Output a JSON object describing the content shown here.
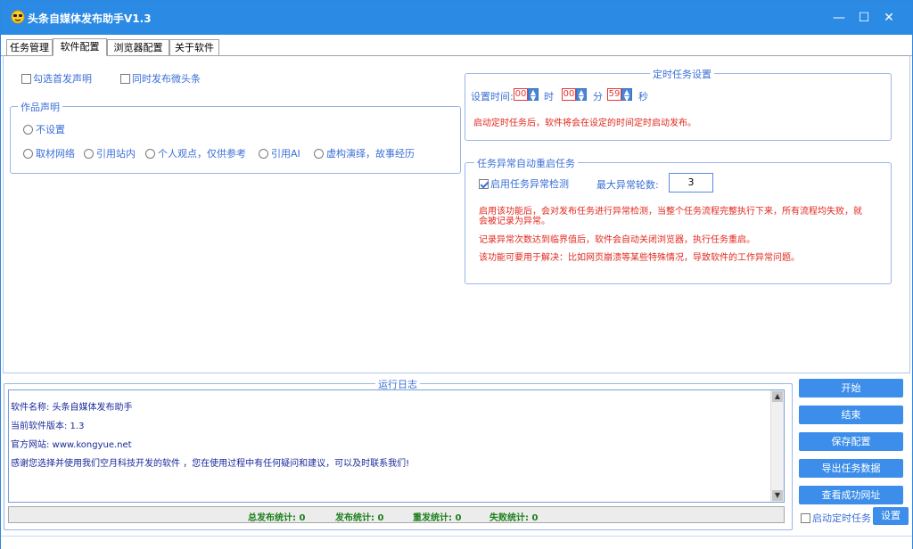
{
  "window": {
    "title": "头条自媒体发布助手V1.3",
    "minimize": "—",
    "maximize": "☐",
    "close": "✕"
  },
  "tabs": [
    {
      "label": "任务管理"
    },
    {
      "label": "软件配置"
    },
    {
      "label": "浏览器配置"
    },
    {
      "label": "关于软件"
    }
  ],
  "config": {
    "first_declare_label": "勾选首发声明",
    "sync_weitoutiao_label": "同时发布微头条",
    "declare_group_title": "作品声明",
    "declare_options": [
      {
        "label": "不设置"
      },
      {
        "label": "取材网络"
      },
      {
        "label": "引用站内"
      },
      {
        "label": "个人观点，仅供参考"
      },
      {
        "label": "引用AI"
      },
      {
        "label": "虚构演绎，故事经历"
      }
    ]
  },
  "scheduled": {
    "group_title": "定时任务设置",
    "set_time_label": "设置时间:",
    "hour": "00",
    "hour_unit": "时",
    "minute": "00",
    "minute_unit": "分",
    "second": "59",
    "second_unit": "秒",
    "note": "启动定时任务后，软件将会在设定的时间定时启动发布。"
  },
  "restart": {
    "group_title": "任务异常自动重启任务",
    "enable_label": "启用任务异常检测",
    "max_label": "最大异常轮数:",
    "max_value": "3",
    "note1a": "启用该功能后，会对发布任务进行异常检测，当整个任务流程完整执行下来，所有流程均失败，就",
    "note1b": "会被记录为异常。",
    "note2": "记录异常次数达到临界值后，软件会自动关闭浏览器，执行任务重启。",
    "note3": "该功能可要用于解决：比如网页崩溃等某些特殊情况，导致软件的工作异常问题。"
  },
  "log": {
    "title": "运行日志",
    "lines": [
      "软件名称: 头条自媒体发布助手",
      "当前软件版本: 1.3",
      "官方网站: www.kongyue.net",
      "感谢您选择并使用我们空月科技开发的软件 ，您在使用过程中有任何疑问和建议，可以及时联系我们!"
    ]
  },
  "stats": {
    "total": "总发布统计: 0",
    "publish": "发布统计: 0",
    "repost": "重发统计: 0",
    "fail": "失败统计: 0"
  },
  "actions": {
    "start": "开始",
    "stop": "结束",
    "save": "保存配置",
    "export": "导出任务数据",
    "view_success": "查看成功网址",
    "enable_schedule": "启动定时任务",
    "settings": "设置"
  },
  "colors": {
    "titlebar": "#2b8ae4",
    "accent_text": "#3c6fd6",
    "warning_text": "#e0281e",
    "stats_text": "#1a7f1a",
    "button": "#3c8eea"
  }
}
